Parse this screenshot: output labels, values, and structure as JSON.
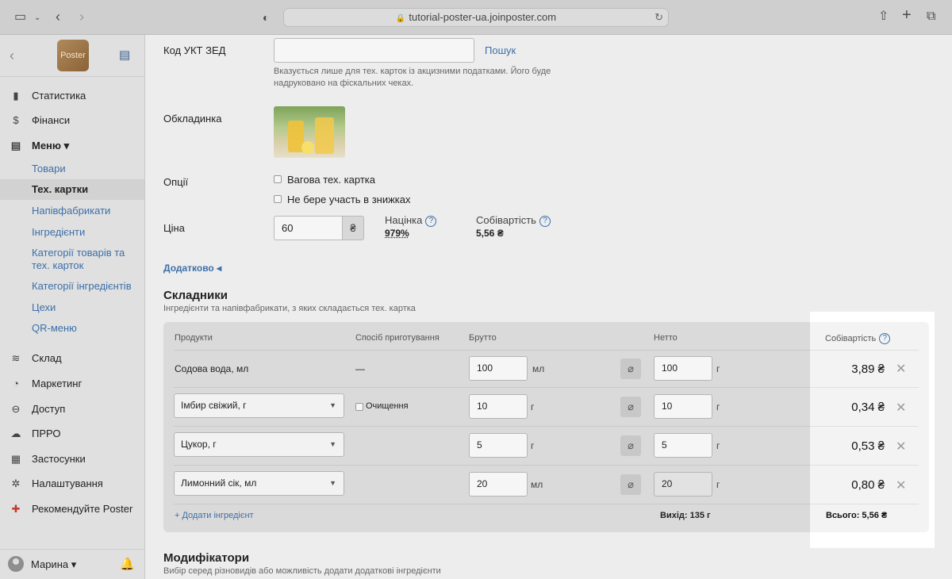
{
  "browser": {
    "url": "tutorial-poster-ua.joinposter.com"
  },
  "sidebar": {
    "logo_text": "Poster",
    "nav": [
      {
        "label": "Статистика",
        "icon": "bar-chart-icon"
      },
      {
        "label": "Фінанси",
        "icon": "dollar-icon"
      },
      {
        "label": "Меню",
        "icon": "document-icon"
      }
    ],
    "menu_items": [
      "Товари",
      "Тех. картки",
      "Напівфабрикати",
      "Інгредієнти",
      "Категорії товарів та тех. карток",
      "Категорії інгредієнтів",
      "Цехи",
      "QR-меню"
    ],
    "nav2": [
      {
        "label": "Склад",
        "icon": "layers-icon"
      },
      {
        "label": "Маркетинг",
        "icon": "pie-icon"
      },
      {
        "label": "Доступ",
        "icon": "lock-icon"
      },
      {
        "label": "ПРРО",
        "icon": "cloud-icon"
      },
      {
        "label": "Застосунки",
        "icon": "grid-icon"
      },
      {
        "label": "Налаштування",
        "icon": "gear-icon"
      },
      {
        "label": "Рекомендуйте Poster",
        "icon": "gift-icon"
      }
    ],
    "user": "Марина"
  },
  "form": {
    "uktzed_label": "Код УКТ ЗЕД",
    "uktzed_value": "",
    "search_link": "Пошук",
    "uktzed_hint_1": "Вказується лише для тех. карток із акцизними податками. Його буде",
    "uktzed_hint_2": "надруковано на фіскальних чеках.",
    "cover_label": "Обкладинка",
    "options_label": "Опції",
    "option_weight": "Вагова тех. картка",
    "option_discount": "Не бере участь в знижках",
    "price_label": "Ціна",
    "price_value": "60",
    "currency": "₴",
    "markup_label": "Націнка",
    "markup_value": "979%",
    "cost_label": "Собівартість",
    "cost_value": "5,56 ₴",
    "additional_link": "Додатково"
  },
  "ingredients": {
    "title": "Складники",
    "subtitle": "Інгредієнти та напівфабрикати, з яких складається тех. картка",
    "headers": {
      "product": "Продукти",
      "method": "Спосіб приготування",
      "gross": "Брутто",
      "net": "Нетто",
      "cost": "Собівартість"
    },
    "rows": [
      {
        "product": "Содова вода, мл",
        "method": "—",
        "gross": "100",
        "gross_unit": "мл",
        "net": "100",
        "net_unit": "г",
        "cost": "3,89 ₴"
      },
      {
        "product": "Імбир свіжий, г",
        "method": "Очищення",
        "gross": "10",
        "gross_unit": "г",
        "net": "10",
        "net_unit": "г",
        "cost": "0,34 ₴"
      },
      {
        "product": "Цукор, г",
        "method": "",
        "gross": "5",
        "gross_unit": "г",
        "net": "5",
        "net_unit": "г",
        "cost": "0,53 ₴"
      },
      {
        "product": "Лимонний сік, мл",
        "method": "",
        "gross": "20",
        "gross_unit": "мл",
        "net": "20",
        "net_unit": "г",
        "cost": "0,80 ₴"
      }
    ],
    "add_link": "+ Додати інгредієнт",
    "yield": "Вихід: 135 г",
    "total": "Всього: 5,56 ₴"
  },
  "modifiers": {
    "title": "Модифікатори",
    "subtitle": "Вибір серед різновидів або можливість додати додаткові інгредієнти"
  }
}
